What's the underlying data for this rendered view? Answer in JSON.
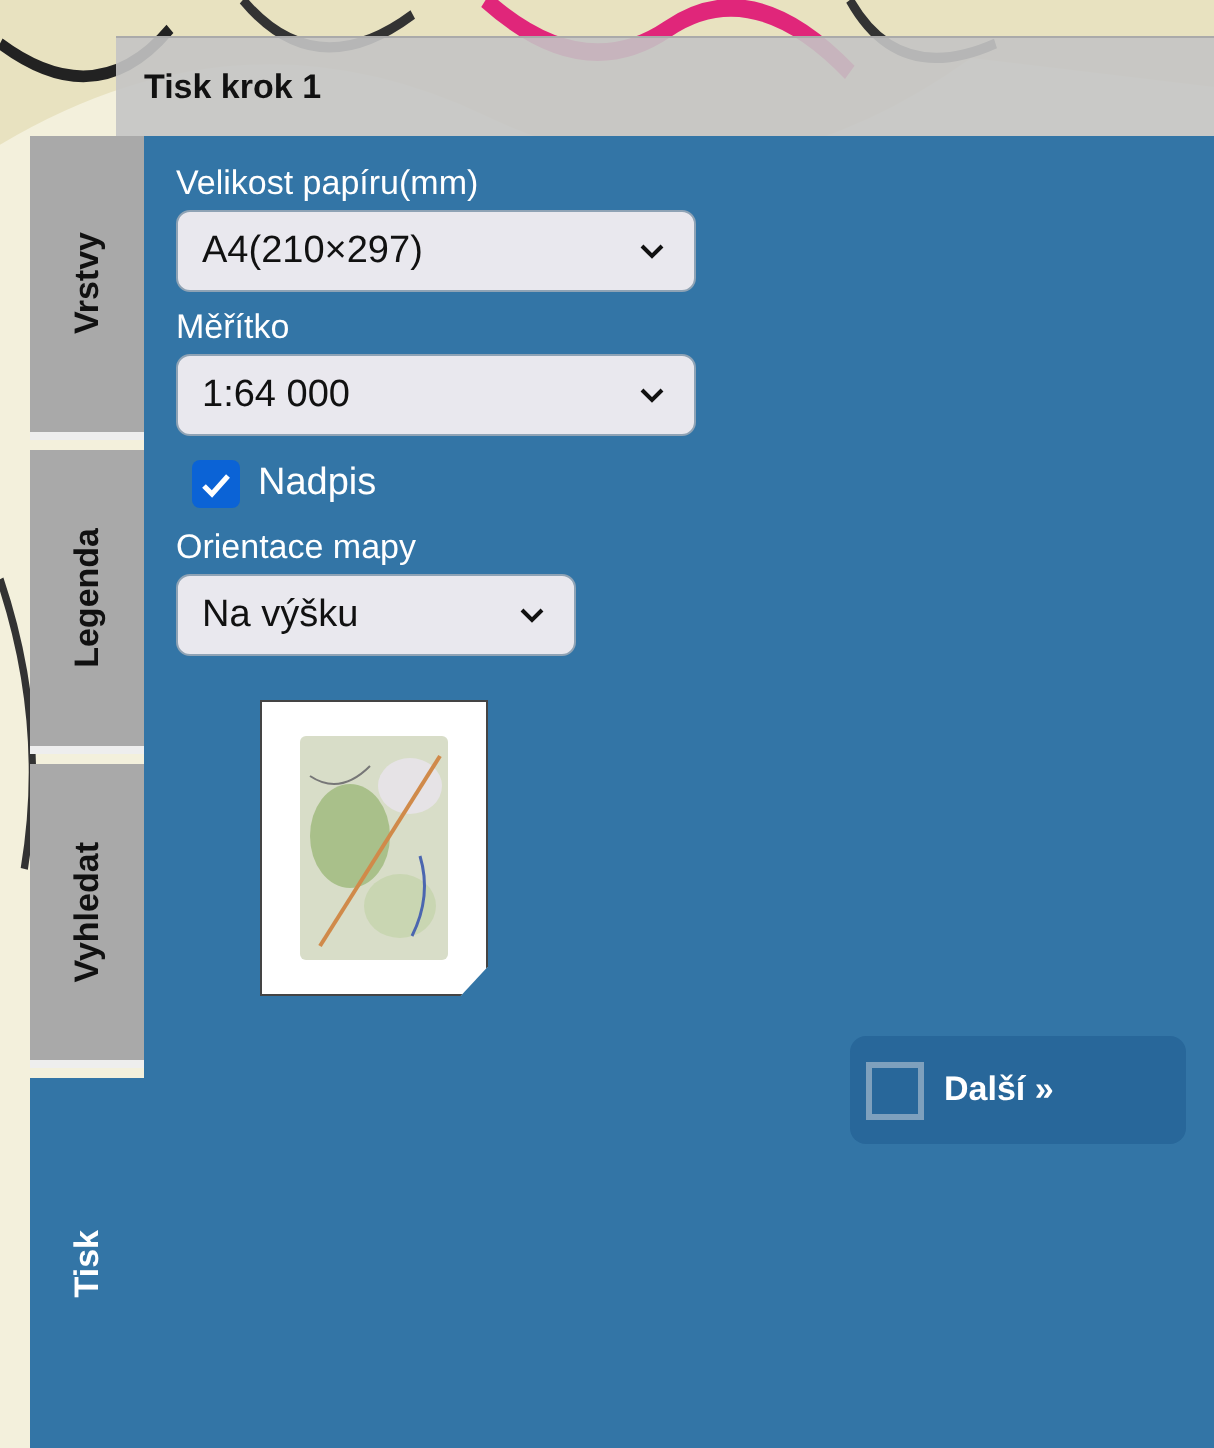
{
  "header": {
    "title": "Tisk krok 1"
  },
  "tabs": [
    {
      "label": "Vrstvy",
      "selected": false
    },
    {
      "label": "Legenda",
      "selected": false
    },
    {
      "label": "Vyhledat",
      "selected": false
    },
    {
      "label": "Tisk",
      "selected": true
    }
  ],
  "form": {
    "paper_size": {
      "label": "Velikost papíru(mm)",
      "value": "A4(210×297)"
    },
    "scale": {
      "label": "Měřítko",
      "value": "1:64 000"
    },
    "title_checkbox": {
      "label": "Nadpis",
      "checked": true
    },
    "orientation": {
      "label": "Orientace mapy",
      "value": "Na výšku"
    }
  },
  "next_button": {
    "label": "Další »"
  }
}
